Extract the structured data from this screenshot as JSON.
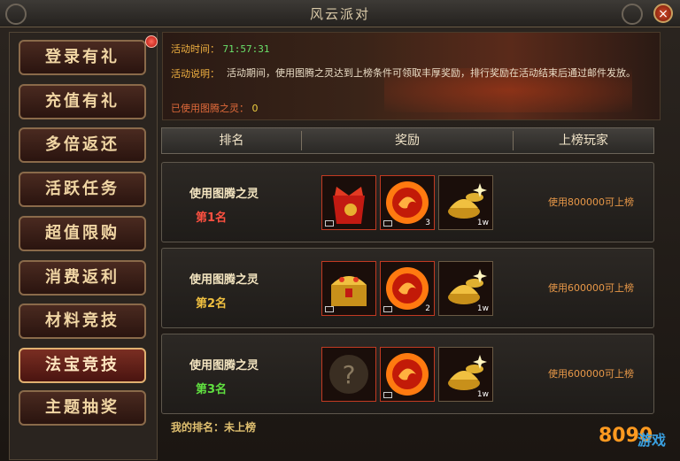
{
  "window": {
    "title": "风云派对",
    "close_label": "×"
  },
  "sidebar": {
    "items": [
      {
        "label": "登录有礼"
      },
      {
        "label": "充值有礼"
      },
      {
        "label": "多倍返还"
      },
      {
        "label": "活跃任务"
      },
      {
        "label": "超值限购"
      },
      {
        "label": "消费返利"
      },
      {
        "label": "材料竞技"
      },
      {
        "label": "法宝竞技"
      },
      {
        "label": "主题抽奖"
      }
    ],
    "active_index": 7
  },
  "banner": {
    "time_label": "活动时间：",
    "time_value": "71:57:31",
    "desc_label": "活动说明：",
    "desc_text": "活动期间，使用图腾之灵达到上榜条件可领取丰厚奖励，排行奖励在活动结束后通过邮件发放。",
    "used_label": "已使用图腾之灵：",
    "used_value": "0"
  },
  "table": {
    "headers": [
      "排名",
      "奖励",
      "上榜玩家"
    ],
    "rows": [
      {
        "title": "使用图腾之灵",
        "rank": "第1名",
        "items": [
          {
            "icon": "red-gift-bag-icon",
            "count": ""
          },
          {
            "icon": "totem-orb-icon",
            "count": "3"
          },
          {
            "icon": "gold-ingot-icon",
            "count": "1w"
          }
        ],
        "requirement": "使用800000可上榜"
      },
      {
        "title": "使用图腾之灵",
        "rank": "第2名",
        "items": [
          {
            "icon": "treasure-chest-icon",
            "count": ""
          },
          {
            "icon": "totem-orb-icon",
            "count": "2"
          },
          {
            "icon": "gold-ingot-icon",
            "count": "1w"
          }
        ],
        "requirement": "使用600000可上榜"
      },
      {
        "title": "使用图腾之灵",
        "rank": "第3名",
        "items": [
          {
            "icon": "mystery-item-icon",
            "count": ""
          },
          {
            "icon": "totem-orb-icon",
            "count": ""
          },
          {
            "icon": "gold-ingot-icon",
            "count": "1w"
          }
        ],
        "requirement": "使用600000可上榜"
      }
    ]
  },
  "my_rank": {
    "label": "我的排名：",
    "value": "未上榜"
  },
  "watermark": {
    "text": "8090",
    "sub": "游戏"
  },
  "colors": {
    "accent": "#c23a22",
    "gold": "#f0c040",
    "text": "#eaddc6"
  }
}
